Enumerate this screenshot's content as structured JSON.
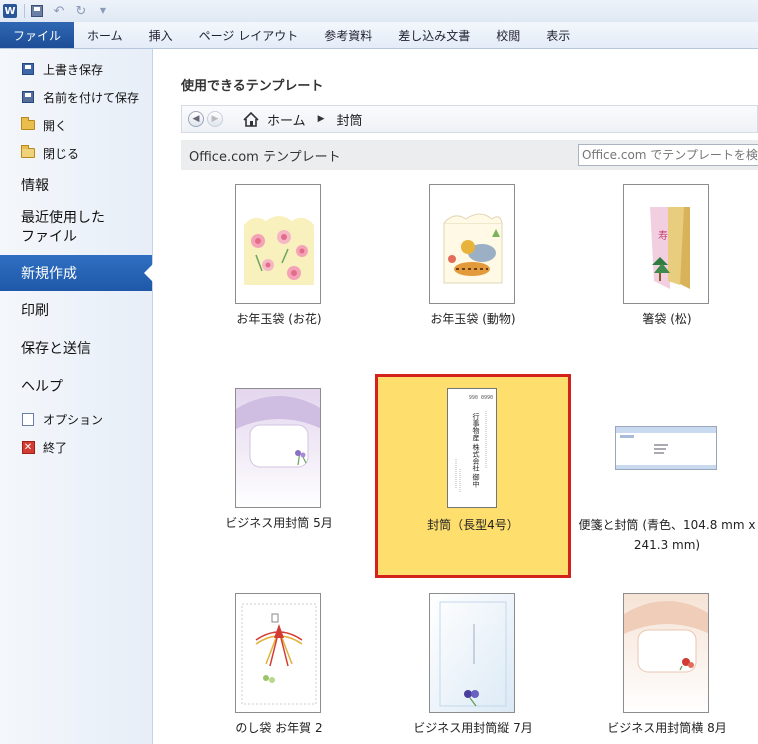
{
  "ribbon": {
    "tabs": [
      "ファイル",
      "ホーム",
      "挿入",
      "ページ レイアウト",
      "参考資料",
      "差し込み文書",
      "校閲",
      "表示"
    ]
  },
  "backstage": {
    "small_items": [
      {
        "label": "上書き保存",
        "icon": "save-icon"
      },
      {
        "label": "名前を付けて保存",
        "icon": "save-as-icon"
      },
      {
        "label": "開く",
        "icon": "open-folder-icon"
      },
      {
        "label": "閉じる",
        "icon": "close-folder-icon"
      }
    ],
    "info": "情報",
    "recent_line1": "最近使用した",
    "recent_line2": "ファイル",
    "new": "新規作成",
    "print": "印刷",
    "save_send": "保存と送信",
    "help": "ヘルプ",
    "options": "オプション",
    "exit": "終了"
  },
  "main": {
    "section_title": "使用できるテンプレート",
    "breadcrumb": {
      "home": "ホーム",
      "current": "封筒"
    },
    "office_label": "Office.com テンプレート",
    "search_placeholder": "Office.com でテンプレートを検索"
  },
  "templates": [
    {
      "name": "お年玉袋 (お花)"
    },
    {
      "name": "お年玉袋 (動物)"
    },
    {
      "name": "箸袋 (松)"
    },
    {
      "name": "ビジネス用封筒 5月"
    },
    {
      "name": "封筒（長型4号）",
      "selected": true,
      "thumb_postcode": "990 0990",
      "thumb_name": "行事物産 株式会社 御中"
    },
    {
      "name_line1": "便箋と封筒 (青色、104.8 mm x",
      "name_line2": "241.3 mm)"
    },
    {
      "name": "のし袋 お年賀 2"
    },
    {
      "name": "ビジネス用封筒縦 7月"
    },
    {
      "name": "ビジネス用封筒横 8月"
    }
  ],
  "colors": {
    "accent": "#1f58a8",
    "selection_bg": "#fede6c",
    "selection_border": "#d4231c"
  }
}
